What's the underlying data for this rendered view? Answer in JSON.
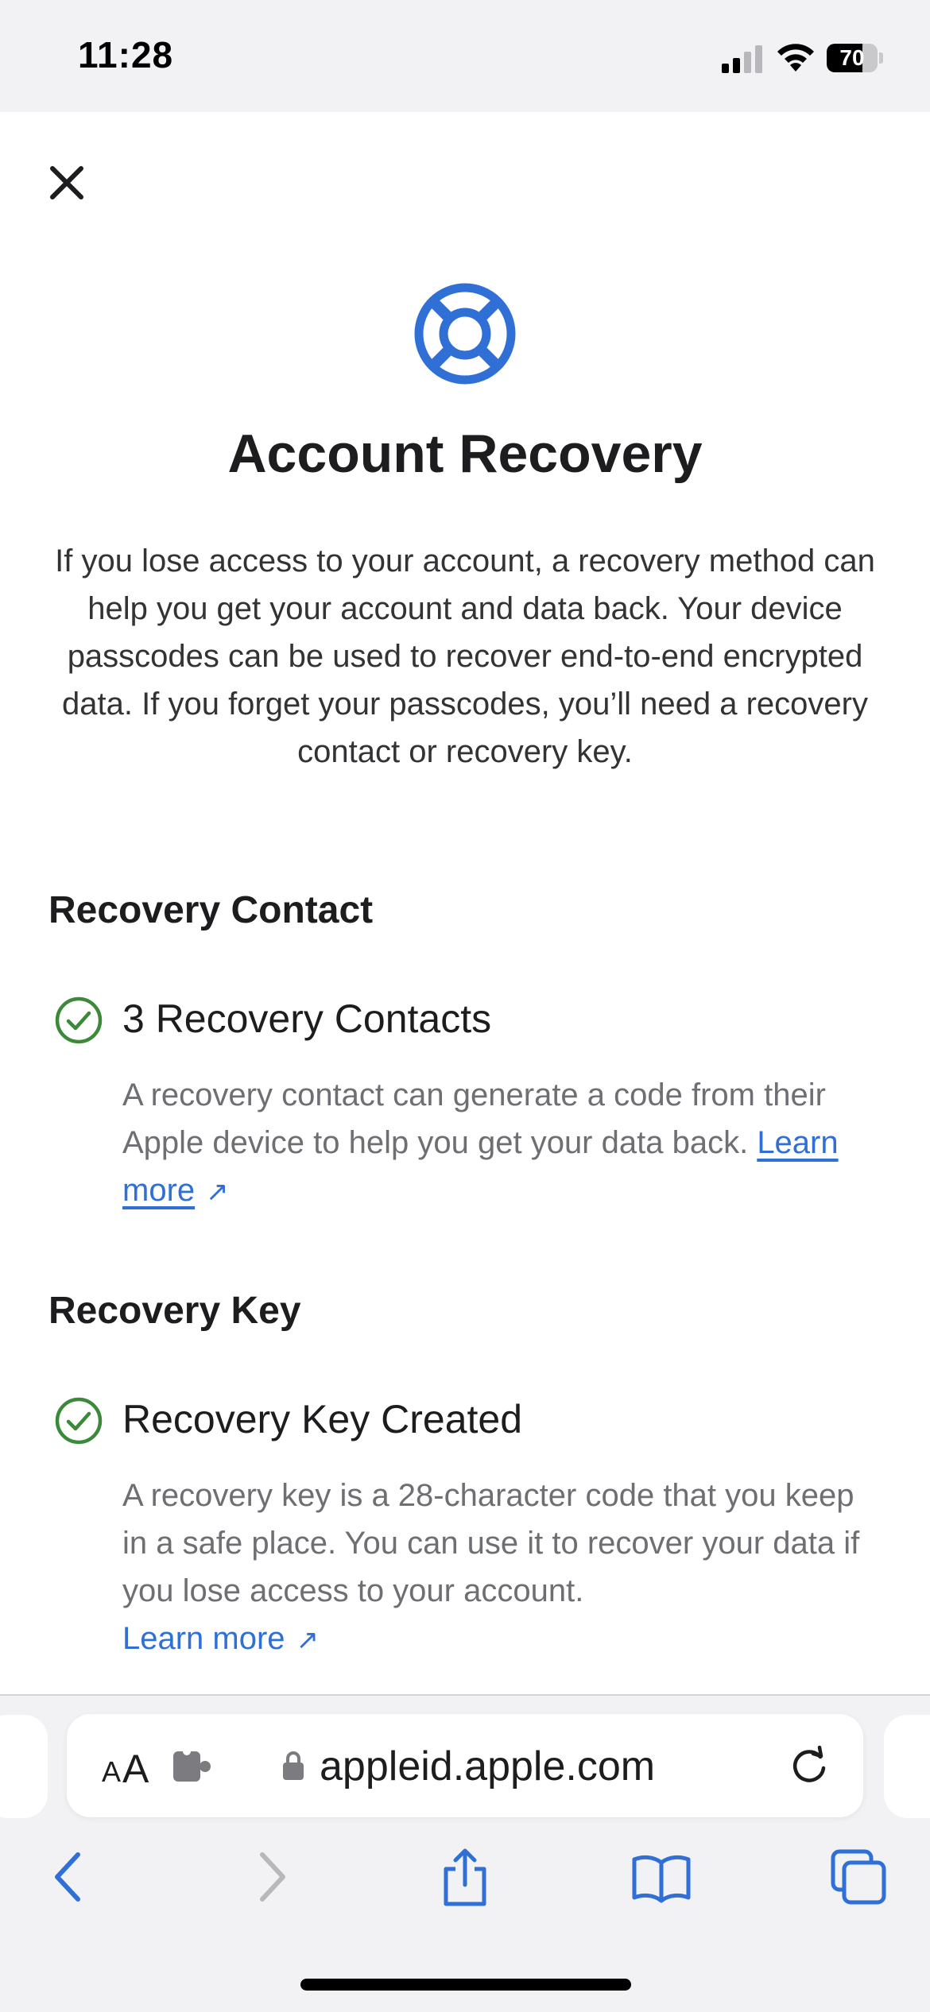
{
  "status_bar": {
    "time": "11:28",
    "battery_level": "70",
    "battery_fraction": 0.7,
    "icons": [
      "signal-icon",
      "wifi-icon",
      "battery-icon"
    ]
  },
  "header": {
    "close_icon": "close-icon",
    "icon": "lifebuoy-icon",
    "title": "Account Recovery",
    "intro": "If you lose access to your account, a recovery method can help you get your account and data back. Your device passcodes can be used to recover end-to-end encrypted data. If you forget your passcodes, you’ll need a recovery contact or recovery key."
  },
  "sections": [
    {
      "heading": "Recovery Contact",
      "item_title": "3 Recovery Contacts",
      "description": "A recovery contact can generate a code from their Apple device to help you get your data back.",
      "link_label": "Learn more",
      "link_arrow": "↗",
      "status_icon": "check-circle-icon"
    },
    {
      "heading": "Recovery Key",
      "item_title": "Recovery Key Created",
      "description": "A recovery key is a 28-character code that you keep in a safe place. You can use it to recover your data if you lose access to your account.",
      "link_label": "Learn more",
      "link_arrow": "↗",
      "status_icon": "check-circle-icon"
    }
  ],
  "browser": {
    "text_size_small": "A",
    "text_size_large": "A",
    "url": "appleid.apple.com",
    "icons": [
      "extension-icon",
      "lock-icon",
      "reload-icon"
    ],
    "toolbar_icons": [
      "back-icon",
      "forward-icon",
      "share-icon",
      "bookmarks-icon",
      "tabs-icon"
    ]
  },
  "colors": {
    "accent": "#2f6fd6",
    "success": "#3b8a3a",
    "background": "#ffffff",
    "chrome": "#f2f2f4",
    "secondary_text": "#6e6e73"
  }
}
